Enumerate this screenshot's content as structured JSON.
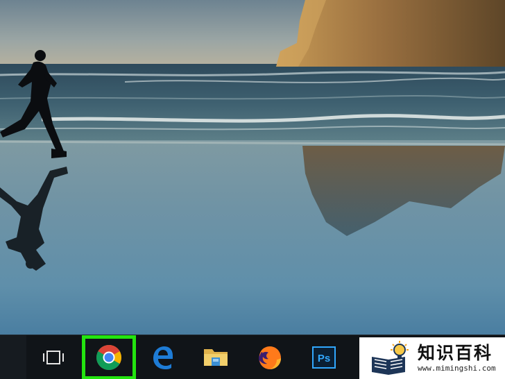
{
  "desktop": {
    "wallpaper": "beach-runner-sunset"
  },
  "taskbar": {
    "items": [
      {
        "id": "task-view",
        "icon": "task-view-icon"
      },
      {
        "id": "chrome",
        "icon": "chrome-icon",
        "highlighted": true
      },
      {
        "id": "edge",
        "icon": "edge-icon"
      },
      {
        "id": "file-explorer",
        "icon": "folder-icon"
      },
      {
        "id": "firefox",
        "icon": "firefox-icon"
      },
      {
        "id": "photoshop",
        "icon": "photoshop-icon",
        "label": "Ps"
      }
    ],
    "highlight_color": "#23e40f"
  },
  "watermark": {
    "title": "知识百科",
    "url": "www.mimingshi.com"
  },
  "colors": {
    "taskbar": "#101418",
    "edge_blue": "#1e7cd6",
    "photoshop_bg": "#0a1f33",
    "photoshop_fg": "#31a8ff"
  }
}
